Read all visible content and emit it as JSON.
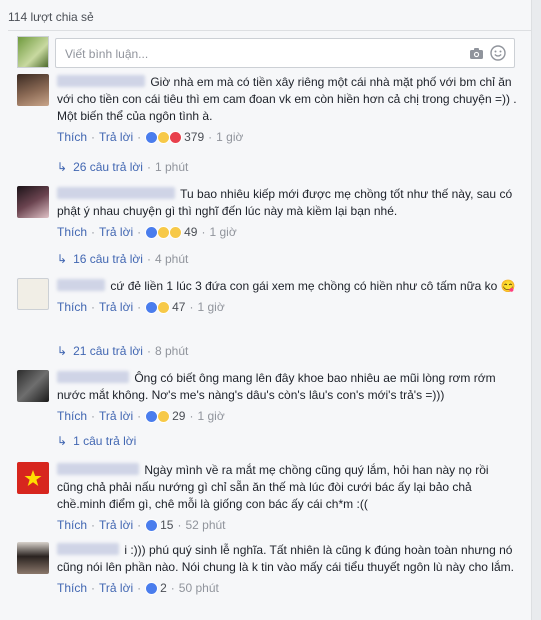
{
  "shares": "114 lượt chia sẻ",
  "composer": {
    "placeholder": "Viết bình luận..."
  },
  "labels": {
    "like": "Thích",
    "reply": "Trả lời",
    "dot": "·"
  },
  "comments": [
    {
      "text": "Giờ nhà em mà có tiền xây riêng một cái nhà mặt phố với bm chỉ ăn với cho tiền con cái tiêu thì em cam đoan vk em còn hiền hơn cả chị trong chuyện =)) . Một biến thể của ngôn tình à.",
      "reactions": "379",
      "reaction_icons": [
        "like-icon",
        "haha-icon",
        "love-icon"
      ],
      "time": "1 giờ",
      "replies": "26 câu trả lời",
      "reply_time": "1 phút"
    },
    {
      "text": "Tu bao nhiêu kiếp mới được mẹ chồng tốt như thế này, sau có phật ý nhau chuyện gì thì nghĩ đến lúc này mà kiềm lại bạn nhé.",
      "reactions": "49",
      "reaction_icons": [
        "like-icon",
        "wow-icon",
        "sad-icon"
      ],
      "time": "1 giờ",
      "replies": "16 câu trả lời",
      "reply_time": "4 phút"
    },
    {
      "text": "cứ đẻ liền 1 lúc 3 đứa con gái xem mẹ chồng có hiền như cô tấm nữa ko 😋",
      "reactions": "47",
      "reaction_icons": [
        "like-icon",
        "haha-icon"
      ],
      "time": "1 giờ",
      "replies": "21 câu trả lời",
      "reply_time": "8 phút"
    },
    {
      "text": "Ông có biết ông mang lên đây khoe bao nhiêu ae mũi lòng rơm rớm nước mắt không. Nơ's me's nàng's dâu's còn's lâu's con's mới's trả's =)))",
      "reactions": "29",
      "reaction_icons": [
        "like-icon",
        "haha-icon"
      ],
      "time": "1 giờ",
      "replies": "1 câu trả lời",
      "reply_time": ""
    },
    {
      "text": "Ngày mình về ra mắt mẹ chồng cũng quý lắm, hỏi han này nọ rồi cũng chả phải nấu nướng gì chỉ sẵn ăn thế mà lúc đòi cưới bác ấy lại bảo chả chề.minh điểm gì, chê mỗi là giống con bác ấy cái ch*m :((",
      "reactions": "15",
      "reaction_icons": [
        "like-icon"
      ],
      "time": "52 phút",
      "replies": "",
      "reply_time": ""
    },
    {
      "text": "i :))) phú quý sinh lễ nghĩa. Tất nhiên là cũng k đúng hoàn toàn nhưng nó cũng nói lên phần nào. Nói chung là k tin vào mấy cái tiểu thuyết ngôn lù này cho lắm.",
      "reactions": "2",
      "reaction_icons": [
        "like-icon"
      ],
      "time": "50 phút",
      "replies": "",
      "reply_time": ""
    }
  ]
}
